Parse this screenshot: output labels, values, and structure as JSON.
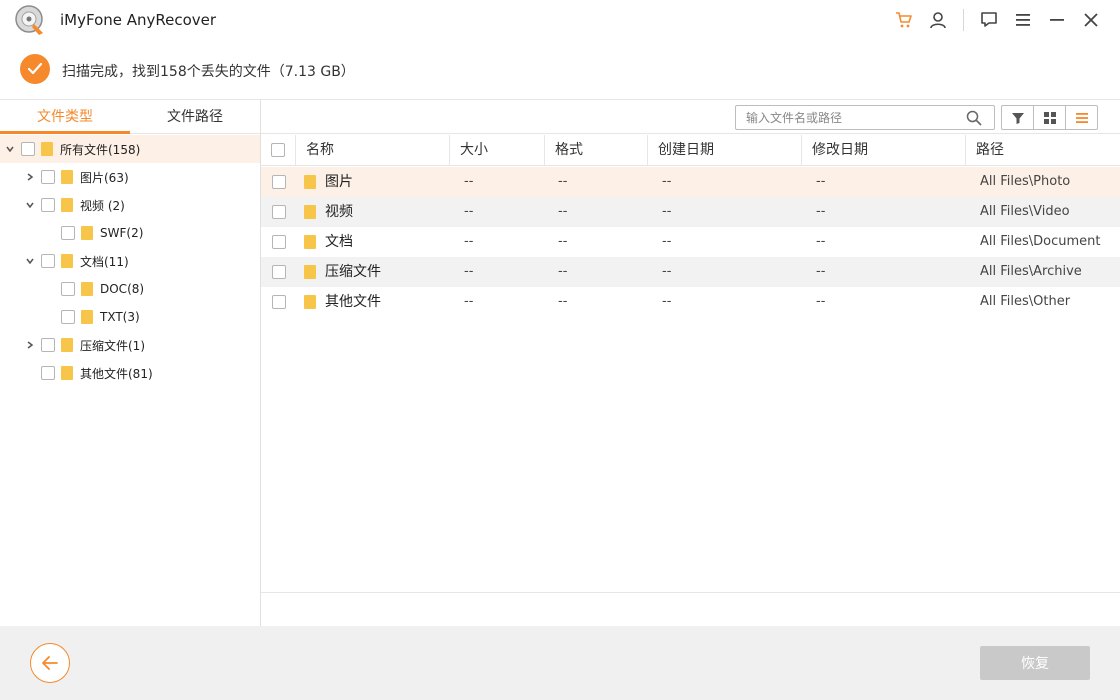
{
  "window": {
    "title": "iMyFone AnyRecover",
    "icons": [
      "cart-icon",
      "user-icon",
      "feedback-icon",
      "menu-icon",
      "minimize-icon",
      "close-icon"
    ]
  },
  "status": {
    "text": "扫描完成，找到158个丢失的文件（7.13 GB）"
  },
  "left_tabs": [
    {
      "label": "文件类型",
      "active": true
    },
    {
      "label": "文件路径",
      "active": false
    }
  ],
  "tree": [
    {
      "label": "所有文件(158)"
    },
    {
      "label": "图片(63)"
    },
    {
      "label": "视频 (2)"
    },
    {
      "label": "SWF(2)"
    },
    {
      "label": "文档(11)"
    },
    {
      "label": "DOC(8)"
    },
    {
      "label": "TXT(3)"
    },
    {
      "label": "压缩文件(1)"
    },
    {
      "label": "其他文件(81)"
    }
  ],
  "search": {
    "placeholder": "输入文件名或路径"
  },
  "columns": [
    "名称",
    "大小",
    "格式",
    "创建日期",
    "修改日期",
    "路径"
  ],
  "rows": [
    {
      "name": "图片",
      "size": "--",
      "format": "--",
      "created": "--",
      "modified": "--",
      "path": "All Files\\Photo"
    },
    {
      "name": "视频",
      "size": "--",
      "format": "--",
      "created": "--",
      "modified": "--",
      "path": "All Files\\Video"
    },
    {
      "name": "文档",
      "size": "--",
      "format": "--",
      "created": "--",
      "modified": "--",
      "path": "All Files\\Document"
    },
    {
      "name": "压缩文件",
      "size": "--",
      "format": "--",
      "created": "--",
      "modified": "--",
      "path": "All Files\\Archive"
    },
    {
      "name": "其他文件",
      "size": "--",
      "format": "--",
      "created": "--",
      "modified": "--",
      "path": "All Files\\Other"
    }
  ],
  "footer": {
    "recover_label": "恢复"
  },
  "colors": {
    "accent": "#f5892b",
    "folder": "#f7c54a",
    "disabled_button": "#c9c9c9"
  }
}
